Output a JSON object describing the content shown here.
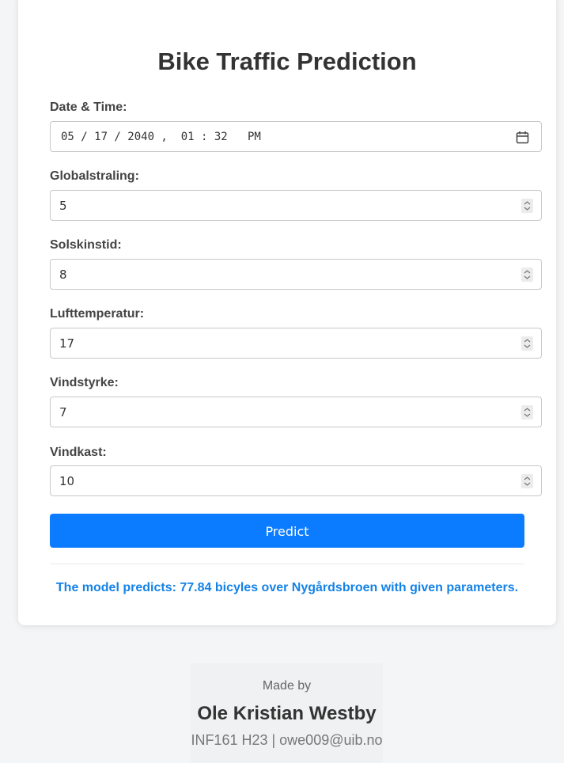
{
  "title": "Bike Traffic Prediction",
  "form": {
    "datetime": {
      "label": "Date & Time:",
      "value": "05 / 17 / 2040 ,  01 : 32   PM",
      "icon": "calendar-icon"
    },
    "globalstraling": {
      "label": "Globalstraling:",
      "value": "5"
    },
    "solskinstid": {
      "label": "Solskinstid:",
      "value": "8"
    },
    "lufttemperatur": {
      "label": "Lufttemperatur:",
      "value": "17"
    },
    "vindstyrke": {
      "label": "Vindstyrke:",
      "value": "7"
    },
    "vindkast": {
      "label": "Vindkast:",
      "value": "10"
    },
    "submit_label": "Predict"
  },
  "result": {
    "text": "The model predicts: 77.84 bicyles over Nygårdsbroen with given parameters."
  },
  "footer": {
    "made_by": "Made by",
    "name": "Ole Kristian Westby",
    "info": "INF161 H23 | owe009@uib.no"
  },
  "colors": {
    "accent": "#0b7bff",
    "result_text": "#1482e6",
    "background": "#f4f5f6"
  }
}
